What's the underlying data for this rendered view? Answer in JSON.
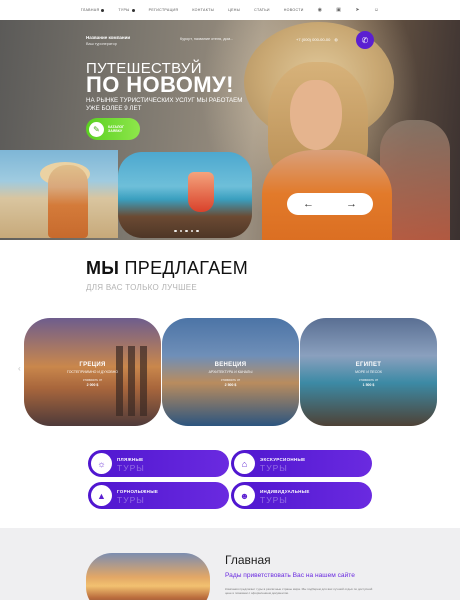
{
  "topnav": {
    "items": [
      "ГЛАВНАЯ",
      "ТУРЫ",
      "РЕГИСТРАЦИЯ",
      "КОНТАКТЫ",
      "ЦЕНЫ",
      "СТАТЬИ",
      "НОВОСТИ"
    ],
    "icons": [
      "vk-icon",
      "ok-icon",
      "telegram-icon",
      "user-icon"
    ]
  },
  "header": {
    "company_name": "Название компании",
    "company_tagline": "Ваш туроператор",
    "search_placeholder": "Курорт, название отеля, дом...",
    "phone": "+7 (000) 000-00-00"
  },
  "hero": {
    "title_line1": "ПУТЕШЕСТВУЙ",
    "title_line2": "ПО НОВОМУ!",
    "subtitle": "НА РЫНКЕ ТУРИСТИЧЕСКИХ УСЛУГ МЫ РАБОТАЕМ УЖЕ БОЛЕЕ 9 ЛЕТ",
    "cta_label_top": "КАТАЛОГ",
    "cta_label": "ЗАЯВКУ",
    "prev_arrow": "←",
    "next_arrow": "→"
  },
  "offer": {
    "title_bold": "МЫ",
    "title_rest": " ПРЕДЛАГАЕМ",
    "subtitle": "ДЛЯ ВАС ТОЛЬКО ЛУЧШЕЕ"
  },
  "destinations": [
    {
      "name": "ГРЕЦИЯ",
      "desc": "ГОСТЕПРИИМНО И ДУХОВНО",
      "price_label": "стоимость от",
      "price": "2 000 $"
    },
    {
      "name": "ВЕНЕЦИЯ",
      "desc": "АРХИТЕКТУРА И КАНАЛЫ",
      "price_label": "стоимость от",
      "price": "2 500 $"
    },
    {
      "name": "ЕГИПЕТ",
      "desc": "МОРЕ И ПЕСОК",
      "price_label": "стоимость от",
      "price": "1 500 $"
    }
  ],
  "tours": [
    {
      "label": "ПЛЯЖНЫЕ",
      "suffix": "ТУРЫ",
      "icon": "beach-icon"
    },
    {
      "label": "ЭКСКУРСИОННЫЕ",
      "suffix": "ТУРЫ",
      "icon": "excursion-icon"
    },
    {
      "label": "ГОРНОЛЫЖНЫЕ",
      "suffix": "ТУРЫ",
      "icon": "mountain-icon"
    },
    {
      "label": "ИНДИВИДУАЛЬНЫЕ",
      "suffix": "ТУРЫ",
      "icon": "people-icon"
    }
  ],
  "main": {
    "title": "Главная",
    "subtitle": "Рады приветствовать Вас на нашем сайте",
    "paragraph": "Компания предлагает туры в различные страны мира. Мы подберем для вас лучший отдых по доступной цене и поможем с оформлением документов."
  }
}
